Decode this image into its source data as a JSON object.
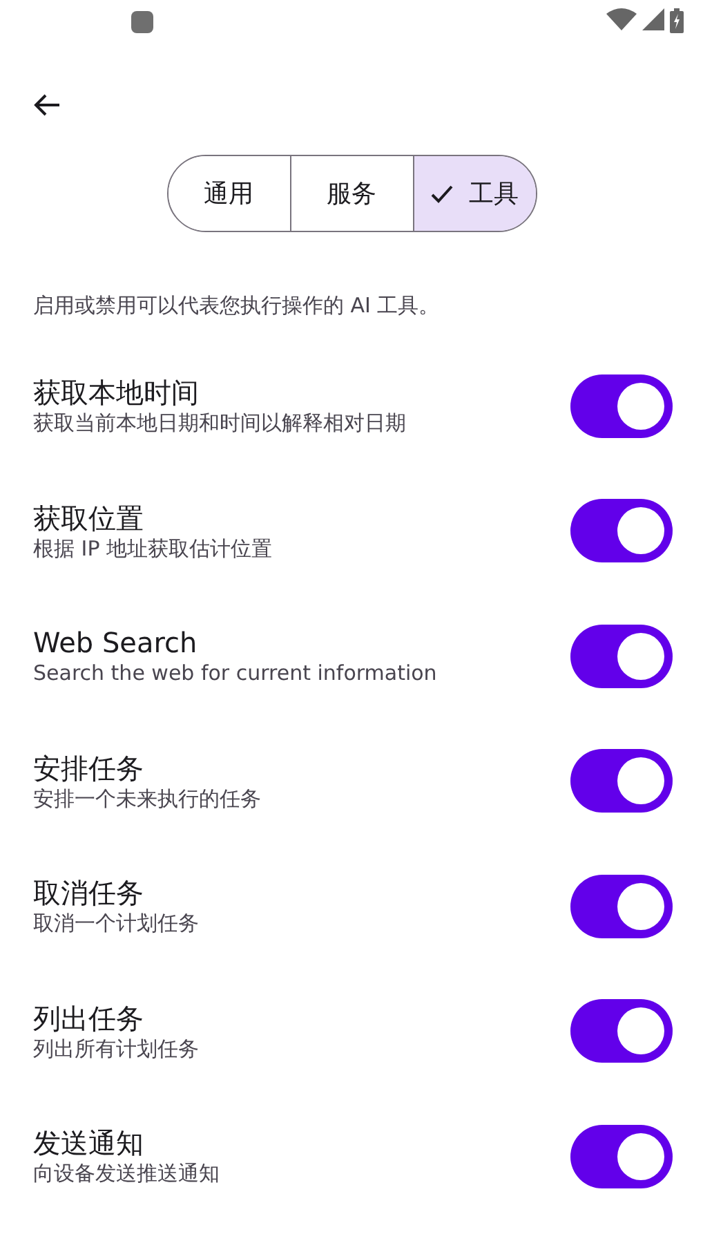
{
  "segments": [
    {
      "label": "通用",
      "selected": false
    },
    {
      "label": "服务",
      "selected": false
    },
    {
      "label": "工具",
      "selected": true
    }
  ],
  "description": "启用或禁用可以代表您执行操作的 AI 工具。",
  "tools": [
    {
      "title": "获取本地时间",
      "subtitle": "获取当前本地日期和时间以解释相对日期",
      "on": true
    },
    {
      "title": "获取位置",
      "subtitle": "根据 IP 地址获取估计位置",
      "on": true
    },
    {
      "title": "Web Search",
      "subtitle": "Search the web for current information",
      "on": true
    },
    {
      "title": "安排任务",
      "subtitle": "安排一个未来执行的任务",
      "on": true
    },
    {
      "title": "取消任务",
      "subtitle": "取消一个计划任务",
      "on": true
    },
    {
      "title": "列出任务",
      "subtitle": "列出所有计划任务",
      "on": true
    },
    {
      "title": "发送通知",
      "subtitle": "向设备发送推送通知",
      "on": true
    }
  ]
}
